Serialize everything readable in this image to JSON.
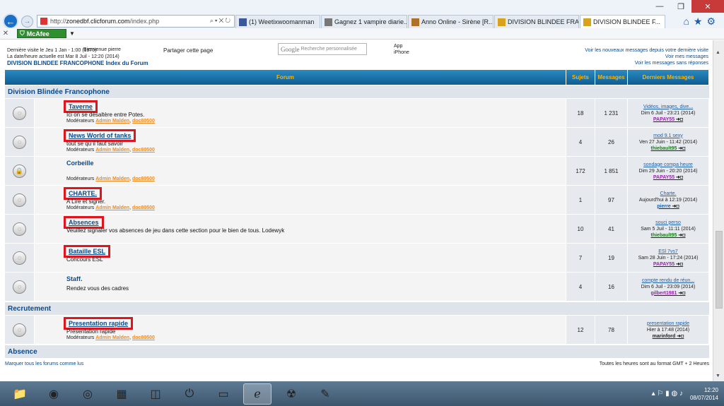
{
  "browser": {
    "address": {
      "prefix": "http://",
      "domain": "zonedbf.clicforum.com",
      "path": "/index.php"
    },
    "tabs": [
      {
        "label": "(1) Weetixwoomanman",
        "icon_color": "#3b5998",
        "active": false
      },
      {
        "label": "Gagnez 1 vampire diarie...",
        "icon_color": "#777777",
        "active": false
      },
      {
        "label": "Anno Online - Sirène [R...",
        "icon_color": "#b0702a",
        "active": false
      },
      {
        "label": "DIVISION BLINDEE FRA...",
        "icon_color": "#d9a21b",
        "active": false
      },
      {
        "label": "DIVISION BLINDEE F...",
        "icon_color": "#d9a21b",
        "active": true
      }
    ],
    "toolbar": {
      "close": "✕",
      "mcafee_label": "McAfee"
    }
  },
  "header": {
    "last_visit_line1": "Dernière visite le Jeu 1 Jan - 1:00 (1970)",
    "overlap_text": "Bienvenue pierre",
    "last_visit_line2": "La date/heure actuelle est Mar 8 Juil - 12:20 (2014)",
    "forum_index": "DIVISION BLINDEE FRANCOPHONE Index du Forum",
    "share": "Partager cette page",
    "google_placeholder": "Recherche personnalisée",
    "google_logo": "Google",
    "app_line1": "App",
    "app_line2": "iPhone",
    "right_links": [
      "Voir les nouveaux messages depuis votre dernière visite",
      "Voir mes messages",
      "Voir les messages sans réponses"
    ]
  },
  "table": {
    "columns": {
      "forum": "Forum",
      "topics": "Sujets",
      "posts": "Messages",
      "last": "Derniers Messages"
    },
    "categories": [
      {
        "name": "Division Blindée Francophone",
        "forums": [
          {
            "name": "Taverne",
            "desc": "Ici on se désaltère entre Potes.",
            "mods_label": "Modérateurs",
            "mod1": "Admin Malden",
            "mod2": "doc80500",
            "topics": "18",
            "posts": "1 231",
            "last_title": "Vidéos, images, dive...",
            "last_date": "Dim 6 Juil - 23:21 (2014)",
            "last_user": "PAPAY55",
            "user_color": "#9a1fb0",
            "locked": false,
            "boxed": true
          },
          {
            "name": "News World of tanks",
            "desc": "tout se qu il faut savoir",
            "mods_label": "Modérateurs",
            "mod1": "Admin Malden",
            "mod2": "doc80500",
            "topics": "4",
            "posts": "26",
            "last_title": "mod 9.1 sexy",
            "last_date": "Ven 27 Juin - 11:42 (2014)",
            "last_user": "thiebault95",
            "user_color": "#1e7a1e",
            "locked": false,
            "boxed": true
          },
          {
            "name": "Corbeille",
            "desc": "",
            "mods_label": "Modérateurs",
            "mod1": "Admin Malden",
            "mod2": "doc80500",
            "topics": "172",
            "posts": "1 851",
            "last_title": "sondage compa heure",
            "last_date": "Dim 29 Juin - 20:20 (2014)",
            "last_user": "PAPAY55",
            "user_color": "#9a1fb0",
            "locked": true,
            "boxed": false
          },
          {
            "name": "CHARTE.",
            "desc": "A Lire et signer.",
            "mods_label": "Modérateurs",
            "mod1": "Admin Malden",
            "mod2": "doc80500",
            "topics": "1",
            "posts": "97",
            "last_title": "Charte.",
            "last_date": "Aujourd'hui à 12:19 (2014)",
            "last_user": "pierre",
            "user_color": "#1f5fa8",
            "locked": false,
            "boxed": true
          },
          {
            "name": "Absences",
            "desc": "Veuillez signaler vos absences de jeu dans cette section pour le bien de tous. Lodewyk",
            "mods_label": "",
            "mod1": "",
            "mod2": "",
            "topics": "10",
            "posts": "41",
            "last_title": "souci perso",
            "last_date": "Sam 5 Juil - 11:11 (2014)",
            "last_user": "thiebault95",
            "user_color": "#1e7a1e",
            "locked": false,
            "boxed": true
          },
          {
            "name": "Bataille ESL",
            "desc": "Concours ESL",
            "mods_label": "",
            "mod1": "",
            "mod2": "",
            "topics": "7",
            "posts": "19",
            "last_title": "ESl 7vs7",
            "last_date": "Sam 28 Juin - 17:24 (2014)",
            "last_user": "PAPAY55",
            "user_color": "#9a1fb0",
            "locked": false,
            "boxed": true
          },
          {
            "name": "Staff.",
            "desc": "Rendez vous des cadres",
            "mods_label": "",
            "mod1": "",
            "mod2": "",
            "topics": "4",
            "posts": "16",
            "last_title": "compte rendu de réun...",
            "last_date": "Dim 6 Juil - 23:09 (2014)",
            "last_user": "gilbert1981",
            "user_color": "#9a1fb0",
            "locked": false,
            "boxed": false
          }
        ]
      },
      {
        "name": "Recrutement",
        "forums": [
          {
            "name": "Presentation rapide",
            "desc": "Présentation rapide",
            "mods_label": "Modérateurs",
            "mod1": "Admin Malden",
            "mod2": "doc80500",
            "topics": "12",
            "posts": "78",
            "last_title": "presentation rapide",
            "last_date": "Hier à 17:48 (2014)",
            "last_user": "marinford",
            "user_color": "#222222",
            "locked": false,
            "boxed": true
          }
        ]
      },
      {
        "name": "Absence",
        "forums": []
      }
    ],
    "mark_all": "Marquer tous les forums comme lus",
    "timezone": "Toutes les heures sont au format GMT + 2 Heures",
    "goto": "➜◘"
  },
  "taskbar": {
    "clock_time": "12:20",
    "clock_date": "08/07/2014"
  }
}
